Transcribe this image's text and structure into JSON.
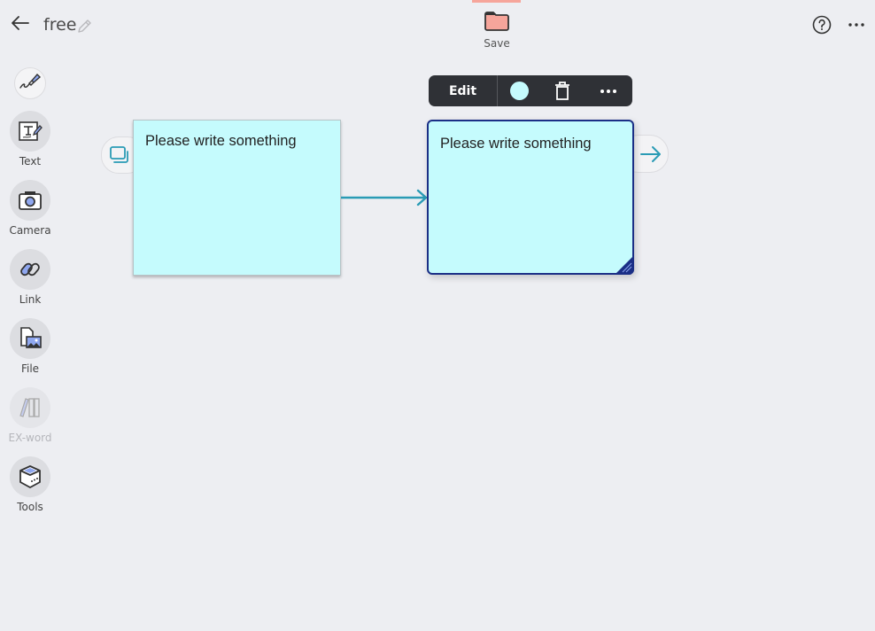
{
  "header": {
    "title": "free",
    "save_label": "Save",
    "icons": {
      "back": "arrow-left-icon",
      "edit_title": "pencil-icon",
      "save": "folder-icon",
      "help": "question-circle-icon",
      "more": "ellipsis-icon"
    }
  },
  "sidebar": {
    "items": [
      {
        "label": "",
        "icon": "pen-icon",
        "active": true
      },
      {
        "label": "Text",
        "icon": "text-edit-icon"
      },
      {
        "label": "Camera",
        "icon": "camera-icon"
      },
      {
        "label": "Link",
        "icon": "link-icon"
      },
      {
        "label": "File",
        "icon": "file-image-icon"
      },
      {
        "label": "EX-word",
        "icon": "books-icon",
        "disabled": true
      },
      {
        "label": "Tools",
        "icon": "toolbox-icon"
      }
    ]
  },
  "canvas": {
    "notes": [
      {
        "text": "Please write something",
        "selected": false
      },
      {
        "text": "Please write something",
        "selected": true
      }
    ]
  },
  "context_toolbar": {
    "edit_label": "Edit",
    "note_color": "#c5fbfd",
    "icons": {
      "delete": "trash-icon",
      "more": "ellipsis-icon"
    }
  },
  "colors": {
    "accent": "#2a9bb5",
    "note_fill": "#c5fbfd",
    "selected_border": "#1b2f86",
    "save_accent": "#f6a59b"
  }
}
